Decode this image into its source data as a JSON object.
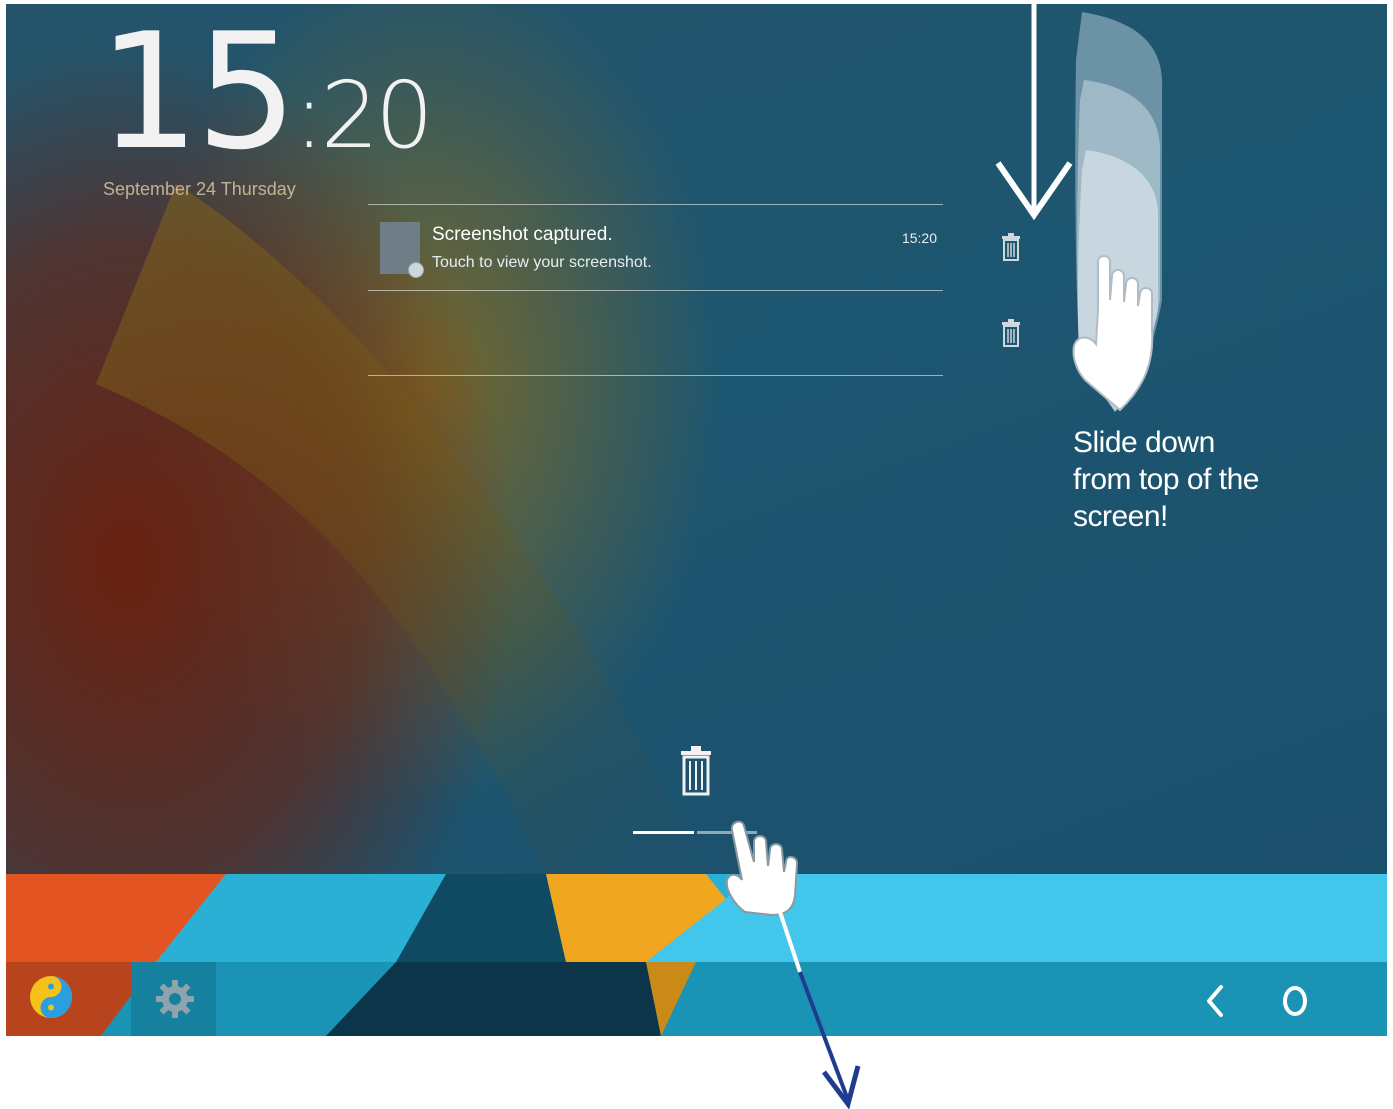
{
  "lockscreen": {
    "clock_hours": "15",
    "clock_minutes": ":20",
    "date": "September 24 Thursday"
  },
  "notifications": [
    {
      "title": "Screenshot captured.",
      "subtitle": "Touch to view your screenshot.",
      "time": "15:20",
      "icon": "screenshot-thumbnail-icon"
    }
  ],
  "dismiss_icons": [
    "trash-icon",
    "trash-icon",
    "trash-icon"
  ],
  "dock": {
    "apps": [
      {
        "icon": "launcher-app-icon"
      },
      {
        "icon": "settings-gear-icon"
      }
    ]
  },
  "navbar": {
    "back_icon": "back-chevron-icon",
    "home_icon": "home-circle-icon"
  },
  "tutorial": {
    "caption_line1": "Slide down",
    "caption_line2": "from top of the",
    "caption_line3": "screen!"
  },
  "colors": {
    "wallpaper_blue": "#1d5670",
    "band_orange": "#e25421",
    "band_yellow": "#f1a620",
    "band_cyan": "#43c6ec",
    "band_teal": "#1a93b4",
    "arrow_blue": "#1f3d8f"
  }
}
